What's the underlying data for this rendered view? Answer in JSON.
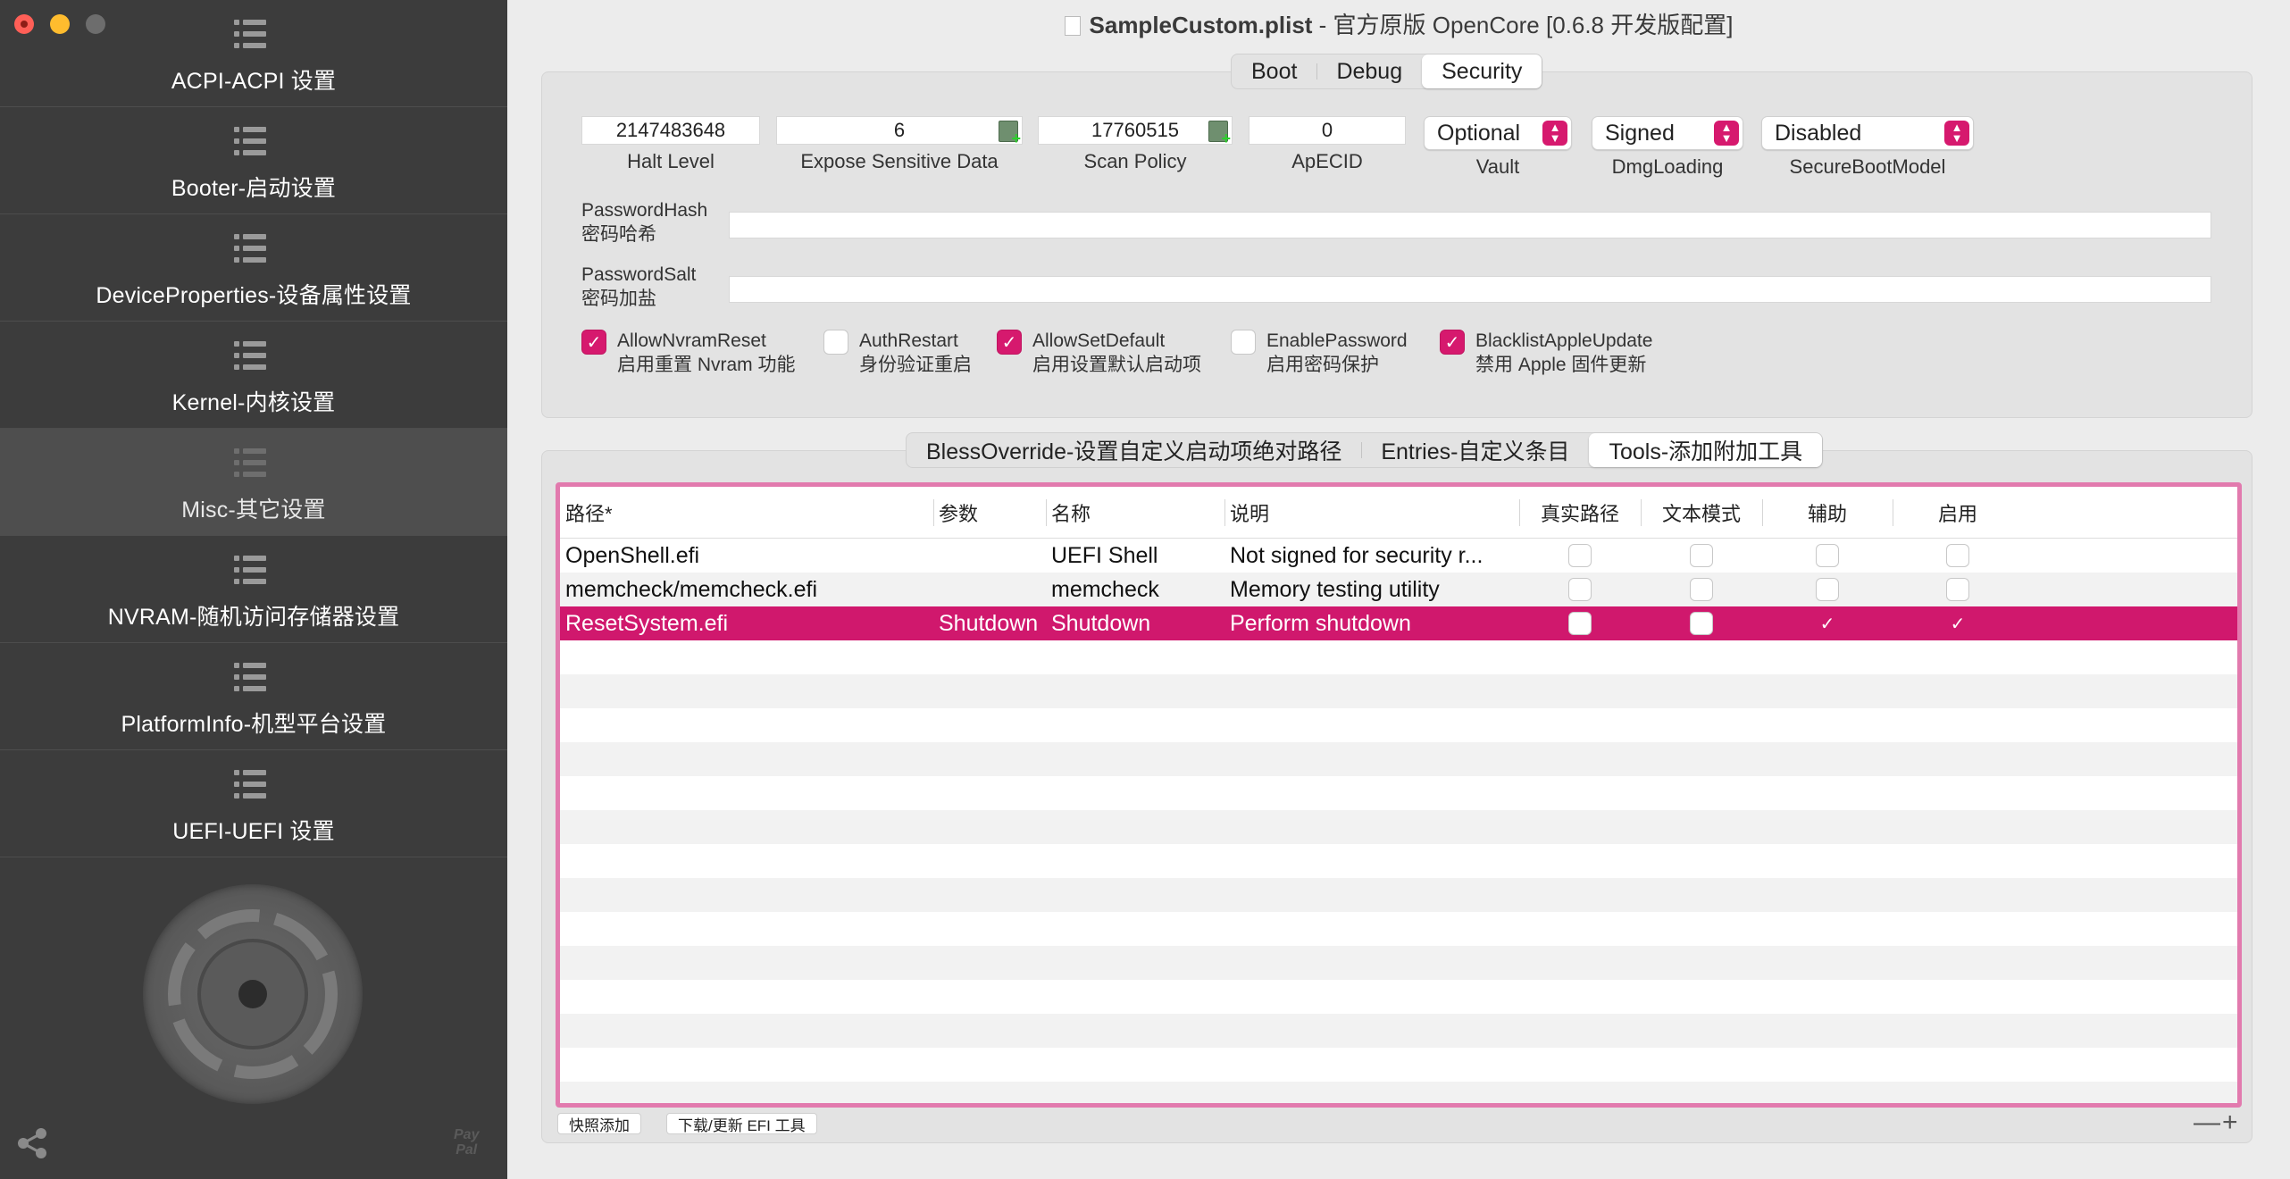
{
  "window": {
    "title_file": "SampleCustom.plist",
    "title_suffix": " - 官方原版 OpenCore [0.6.8 开发版配置]"
  },
  "sidebar": {
    "items": [
      {
        "label": "ACPI-ACPI 设置"
      },
      {
        "label": "Booter-启动设置"
      },
      {
        "label": "DeviceProperties-设备属性设置"
      },
      {
        "label": "Kernel-内核设置"
      },
      {
        "label": "Misc-其它设置"
      },
      {
        "label": "NVRAM-随机访问存储器设置"
      },
      {
        "label": "PlatformInfo-机型平台设置"
      },
      {
        "label": "UEFI-UEFI 设置"
      }
    ],
    "paypal_top": "Pay",
    "paypal_bottom": "Pal"
  },
  "top_tabs": [
    {
      "label": "Boot"
    },
    {
      "label": "Debug"
    },
    {
      "label": "Security"
    }
  ],
  "security": {
    "halt_level": {
      "value": "2147483648",
      "label": "Halt Level"
    },
    "expose_sensitive_data": {
      "value": "6",
      "label": "Expose Sensitive Data"
    },
    "scan_policy": {
      "value": "17760515",
      "label": "Scan Policy"
    },
    "apecid": {
      "value": "0",
      "label": "ApECID"
    },
    "vault": {
      "value": "Optional",
      "label": "Vault"
    },
    "dmg_loading": {
      "value": "Signed",
      "label": "DmgLoading"
    },
    "secure_boot_model": {
      "value": "Disabled",
      "label": "SecureBootModel"
    },
    "password_hash": {
      "label_en": "PasswordHash",
      "label_cn": "密码哈希",
      "value": ""
    },
    "password_salt": {
      "label_en": "PasswordSalt",
      "label_cn": "密码加盐",
      "value": ""
    },
    "checkboxes": [
      {
        "en": "AllowNvramReset",
        "cn": "启用重置 Nvram 功能",
        "checked": true
      },
      {
        "en": "AuthRestart",
        "cn": "身份验证重启",
        "checked": false
      },
      {
        "en": "AllowSetDefault",
        "cn": "启用设置默认启动项",
        "checked": true
      },
      {
        "en": "EnablePassword",
        "cn": "启用密码保护",
        "checked": false
      },
      {
        "en": "BlacklistAppleUpdate",
        "cn": "禁用 Apple 固件更新",
        "checked": true
      }
    ]
  },
  "bottom_tabs": [
    {
      "label": "BlessOverride-设置自定义启动项绝对路径"
    },
    {
      "label": "Entries-自定义条目"
    },
    {
      "label": "Tools-添加附加工具"
    }
  ],
  "tools_table": {
    "columns": [
      "路径*",
      "参数",
      "名称",
      "说明",
      "真实路径",
      "文本模式",
      "辅助",
      "启用"
    ],
    "rows": [
      {
        "path": "OpenShell.efi",
        "args": "",
        "name": "UEFI Shell",
        "comment": "Not signed for security r...",
        "realpath": false,
        "textmode": false,
        "auxiliary": false,
        "enabled": false
      },
      {
        "path": "memcheck/memcheck.efi",
        "args": "",
        "name": "memcheck",
        "comment": "Memory testing utility",
        "realpath": false,
        "textmode": false,
        "auxiliary": false,
        "enabled": false
      },
      {
        "path": "ResetSystem.efi",
        "args": "Shutdown",
        "name": "Shutdown",
        "comment": "Perform shutdown",
        "realpath": false,
        "textmode": false,
        "auxiliary": true,
        "enabled": true
      }
    ]
  },
  "buttons": {
    "snapshot_add": "快照添加",
    "download_update": "下载/更新 EFI 工具",
    "minus": "—",
    "plus": "+"
  }
}
